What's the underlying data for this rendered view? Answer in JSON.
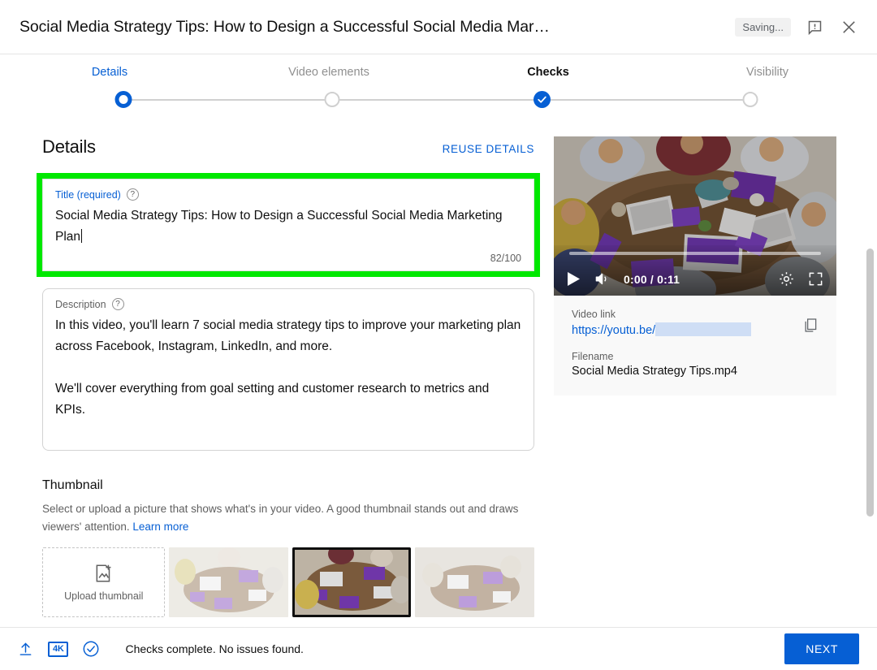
{
  "header": {
    "title": "Social Media Strategy Tips: How to Design a Successful Social Media Mar…",
    "saving_status": "Saving...",
    "feedback_icon": "feedback-speech-bubble-icon",
    "close_icon": "close-x-icon"
  },
  "stepper": {
    "steps": [
      {
        "label": "Details",
        "state": "active"
      },
      {
        "label": "Video elements",
        "state": "pending"
      },
      {
        "label": "Checks",
        "state": "complete"
      },
      {
        "label": "Visibility",
        "state": "pending"
      }
    ]
  },
  "details": {
    "section_title": "Details",
    "reuse_label": "REUSE DETAILS",
    "title_field": {
      "label": "Title (required)",
      "help_icon": "help-question-icon",
      "value": "Social Media Strategy Tips: How to Design a Successful Social Media Marketing Plan",
      "counter": "82/100",
      "highlight_color": "#00e800"
    },
    "description_field": {
      "label": "Description",
      "help_icon": "help-question-icon",
      "value": "In this video, you'll learn 7 social media strategy tips to improve your marketing plan across Facebook, Instagram, LinkedIn, and more.\n\nWe'll cover everything from goal setting and customer research to metrics and KPIs."
    }
  },
  "thumbnail": {
    "title": "Thumbnail",
    "description": "Select or upload a picture that shows what's in your video. A good thumbnail stands out and draws viewers' attention.",
    "learn_more": "Learn more",
    "upload_label": "Upload thumbnail",
    "upload_icon": "image-add-icon",
    "options": [
      {
        "name": "thumbnail-option-1",
        "selected": false
      },
      {
        "name": "thumbnail-option-2",
        "selected": true
      },
      {
        "name": "thumbnail-option-3",
        "selected": false
      }
    ]
  },
  "video_panel": {
    "play_icon": "play-icon",
    "volume_icon": "volume-icon",
    "time": "0:00 / 0:11",
    "settings_icon": "gear-icon",
    "fullscreen_icon": "fullscreen-icon",
    "link_label": "Video link",
    "link_value": "https://youtu.be/",
    "link_redacted": true,
    "copy_icon": "copy-icon",
    "filename_label": "Filename",
    "filename_value": "Social Media Strategy Tips.mp4"
  },
  "footer": {
    "upload_icon": "upload-arrow-icon",
    "quality_badge": "4K",
    "check_icon": "check-circle-icon",
    "status": "Checks complete. No issues found.",
    "next_label": "NEXT",
    "accent_color": "#065fd4"
  }
}
